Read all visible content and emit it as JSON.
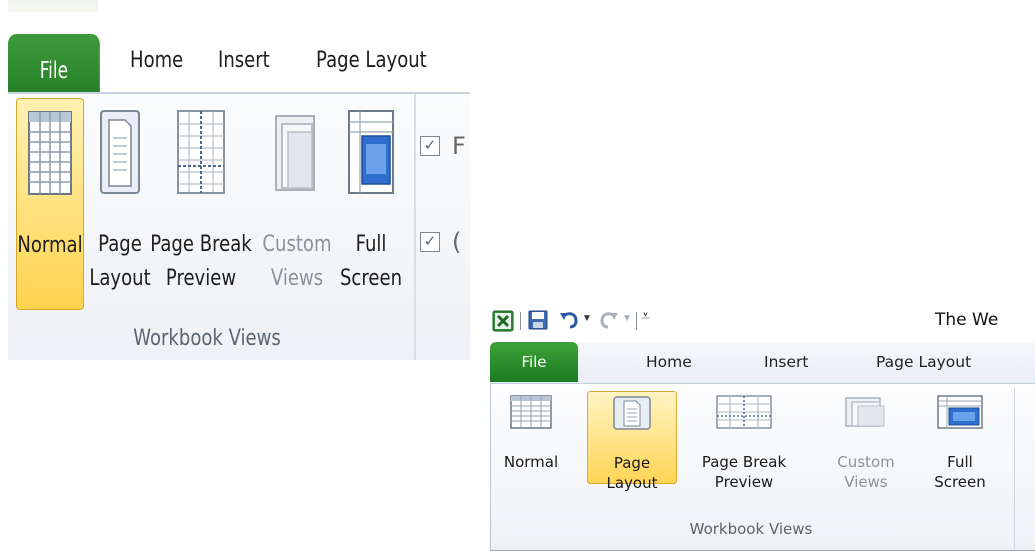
{
  "zoomed_view": {
    "tabs": {
      "file": "File",
      "home": "Home",
      "insert": "Insert",
      "page_layout": "Page Layout"
    },
    "buttons": {
      "normal": {
        "line1": "Normal",
        "line2": ""
      },
      "page_layout": {
        "line1": "Page",
        "line2": "Layout"
      },
      "page_break": {
        "line1": "Page Break",
        "line2": "Preview"
      },
      "custom_views": {
        "line1": "Custom",
        "line2": "Views"
      },
      "full_screen": {
        "line1": "Full",
        "line2": "Screen"
      }
    },
    "group_label": "Workbook Views",
    "checkbox_1_text": "F",
    "checkbox_2_text": "(",
    "active_button": "Normal"
  },
  "standard_view": {
    "window_title": "The We",
    "tabs": {
      "file": "File",
      "home": "Home",
      "insert": "Insert",
      "page_layout": "Page Layout"
    },
    "buttons": {
      "normal": {
        "line1": "Normal",
        "line2": ""
      },
      "page_layout": {
        "line1": "Page",
        "line2": "Layout"
      },
      "page_break": {
        "line1": "Page Break",
        "line2": "Preview"
      },
      "custom_views": {
        "line1": "Custom",
        "line2": "Views"
      },
      "full_screen": {
        "line1": "Full",
        "line2": "Screen"
      }
    },
    "group_label": "Workbook Views",
    "active_button": "Page Layout"
  },
  "colors": {
    "file_tab_green": "#2a8a2b",
    "active_button_yellow": "#ffd34f",
    "disabled_text": "#8a939c"
  }
}
